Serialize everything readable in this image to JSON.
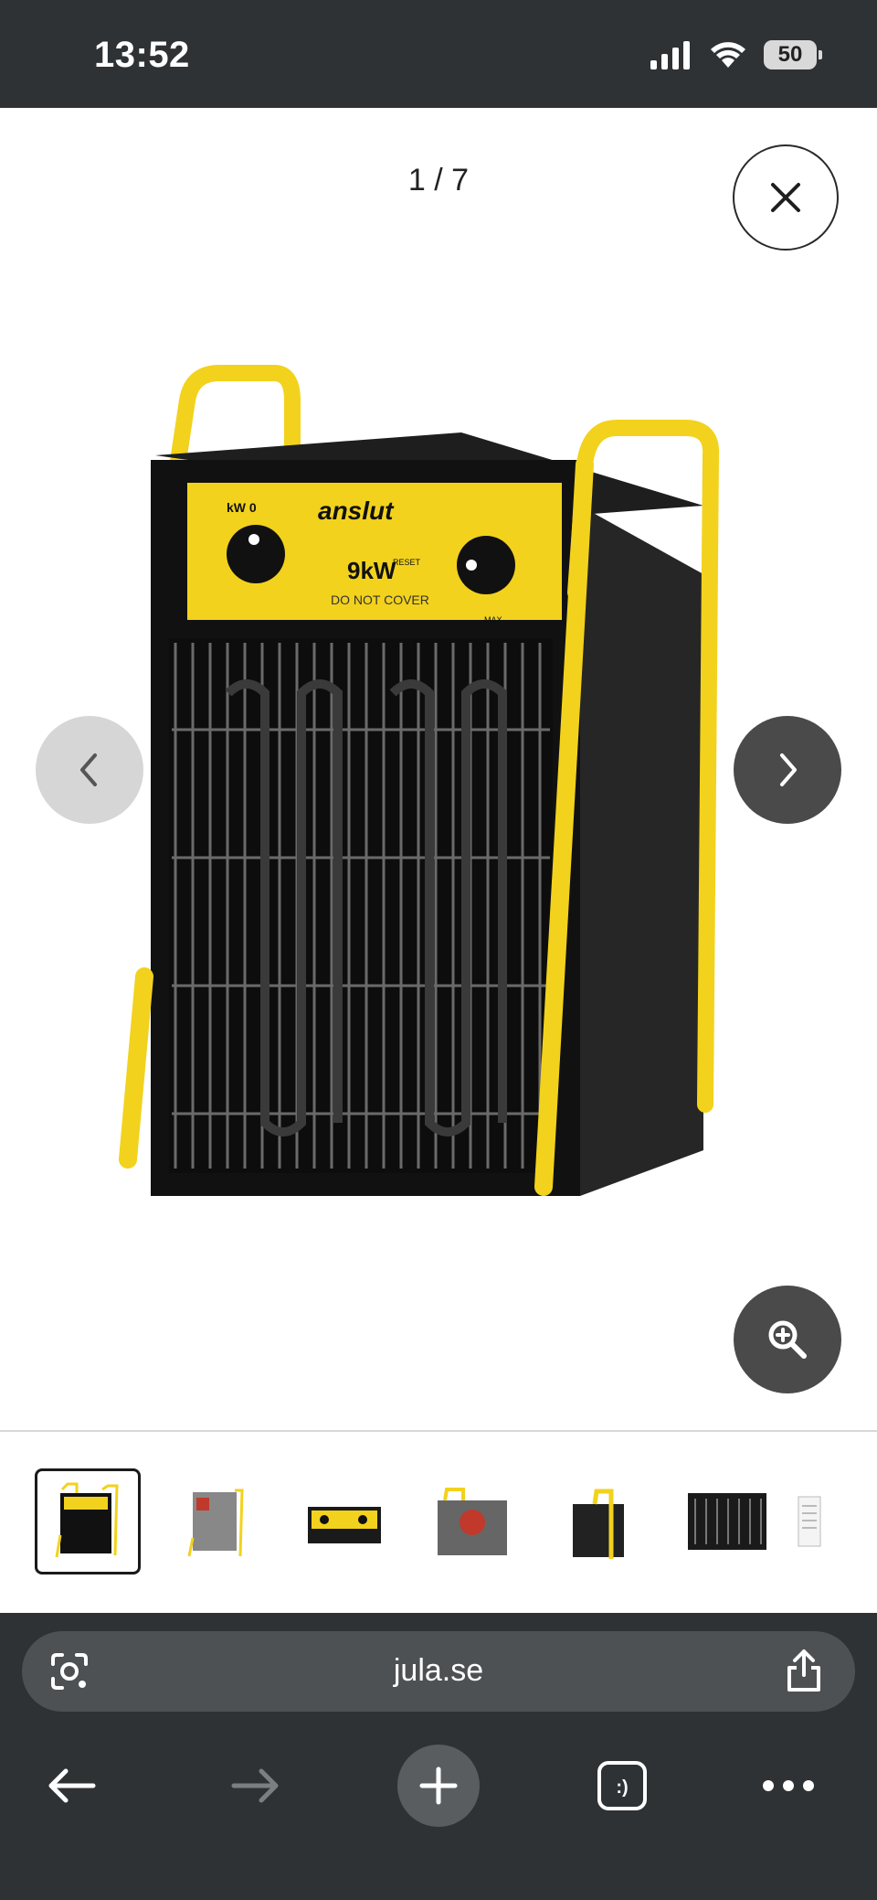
{
  "status_bar": {
    "time": "13:52",
    "battery": "50"
  },
  "viewer": {
    "counter": "1 / 7",
    "product_brand": "anslut",
    "product_power": "9kW",
    "product_warning": "DO NOT COVER",
    "knob_left_label": "kW 0",
    "knob_right_label_reset": "RESET",
    "knob_right_label_max": "MAX"
  },
  "thumbnails": {
    "count": 7,
    "active_index": 0
  },
  "browser": {
    "url": "jula.se"
  },
  "colors": {
    "status_bg": "#2f3235",
    "accent_yellow": "#f2d21d",
    "button_dark": "#4a4a4a"
  }
}
